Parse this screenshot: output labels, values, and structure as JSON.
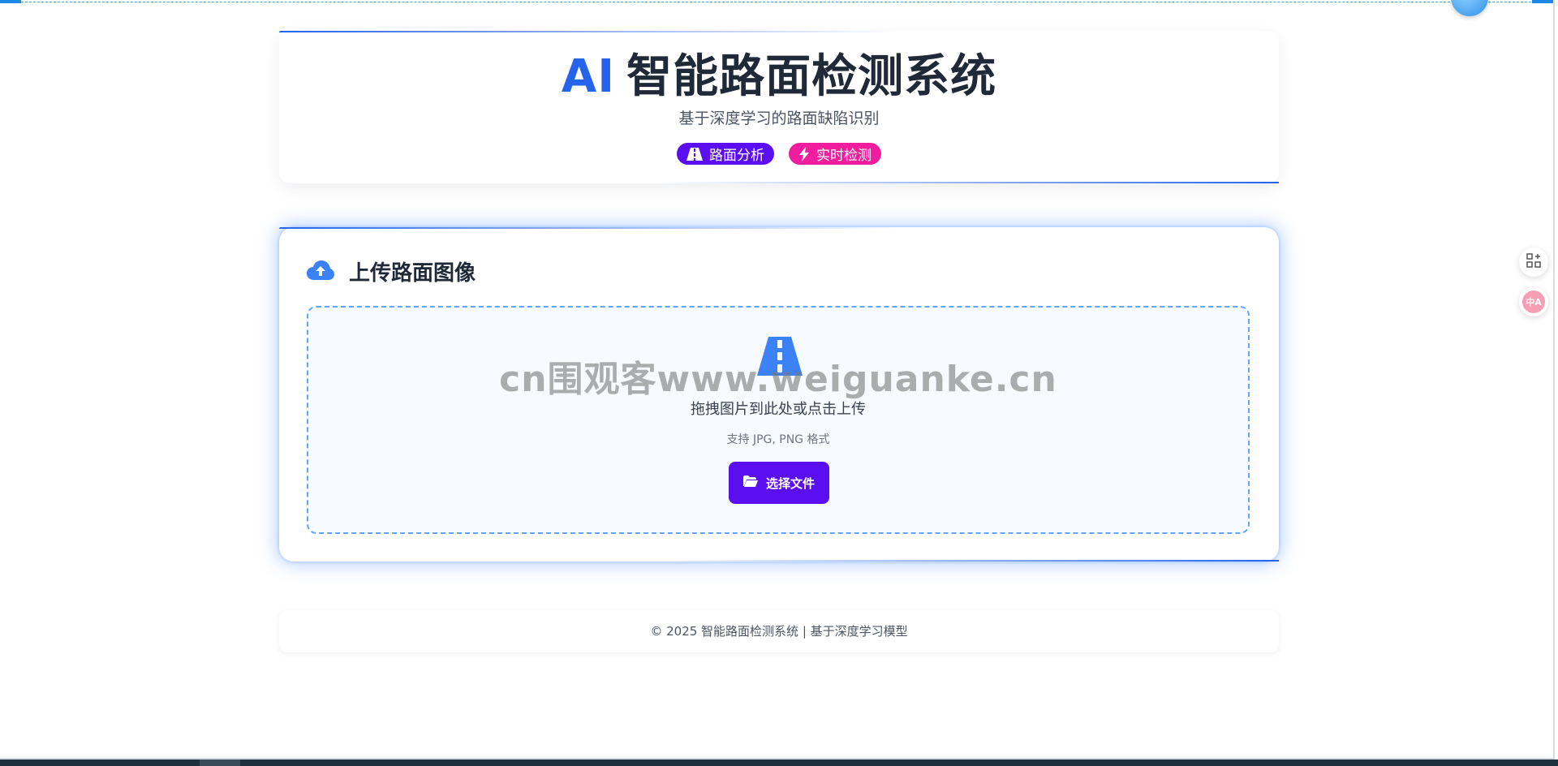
{
  "header": {
    "title_prefix": "AI",
    "title": "智能路面检测系统",
    "subtitle": "基于深度学习的路面缺陷识别",
    "badges": [
      {
        "label": "路面分析",
        "icon": "road-icon",
        "color": "#5b0ef0"
      },
      {
        "label": "实时检测",
        "icon": "bolt-icon",
        "color": "#f01d9f"
      }
    ]
  },
  "upload": {
    "section_title": "上传路面图像",
    "section_icon": "cloud-upload-icon",
    "drop_text": "拖拽图片到此处或点击上传",
    "hint": "支持 JPG, PNG 格式",
    "button_label": "选择文件",
    "button_icon": "folder-open-icon",
    "drop_icon": "road-icon"
  },
  "watermark": "cn围观客www.weiguanke.cn",
  "footer": {
    "text": "© 2025 智能路面检测系统 | 基于深度学习模型"
  },
  "side_tools": {
    "translate_label": "中A"
  },
  "colors": {
    "accent_blue": "#2563eb",
    "purple": "#5b0ef0",
    "pink": "#f01d9f"
  }
}
